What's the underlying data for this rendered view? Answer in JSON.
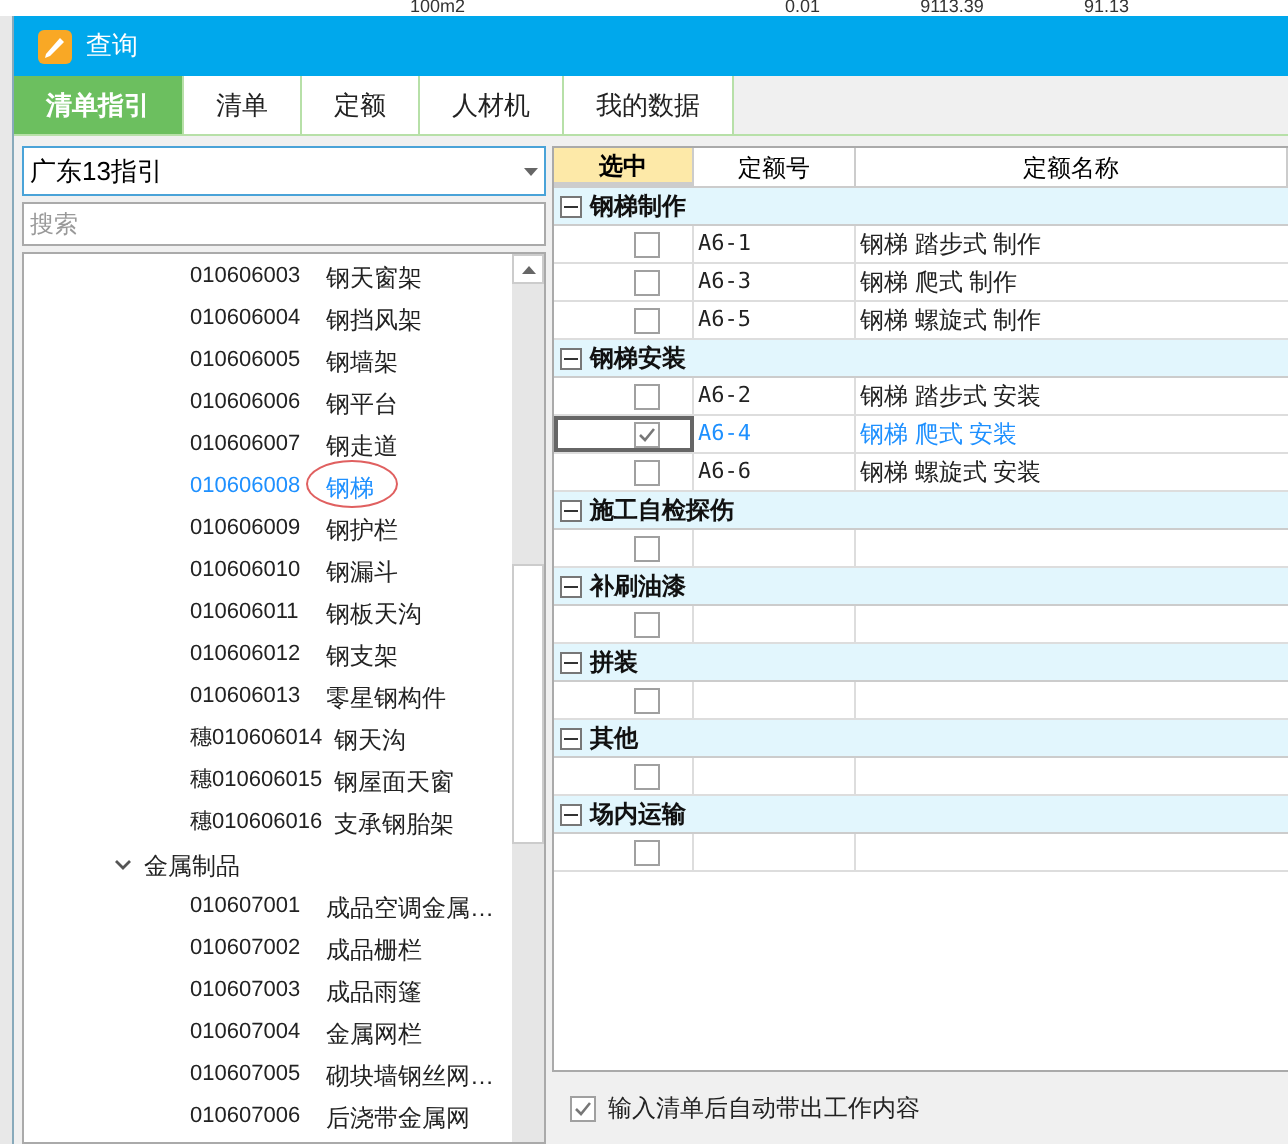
{
  "background_row": [
    "100m2",
    "0.01",
    "9113.39",
    "91.13"
  ],
  "window": {
    "title": "查询"
  },
  "tabs": [
    {
      "label": "清单指引",
      "selected": true
    },
    {
      "label": "清单",
      "selected": false
    },
    {
      "label": "定额",
      "selected": false
    },
    {
      "label": "人材机",
      "selected": false
    },
    {
      "label": "我的数据",
      "selected": false
    }
  ],
  "guide_select": {
    "value": "广东13指引"
  },
  "search": {
    "placeholder": "搜索"
  },
  "tree": [
    {
      "kind": "leaf",
      "code": "010606003",
      "name": "钢天窗架",
      "selected": false
    },
    {
      "kind": "leaf",
      "code": "010606004",
      "name": "钢挡风架",
      "selected": false
    },
    {
      "kind": "leaf",
      "code": "010606005",
      "name": "钢墙架",
      "selected": false
    },
    {
      "kind": "leaf",
      "code": "010606006",
      "name": "钢平台",
      "selected": false
    },
    {
      "kind": "leaf",
      "code": "010606007",
      "name": "钢走道",
      "selected": false
    },
    {
      "kind": "leaf",
      "code": "010606008",
      "name": "钢梯",
      "selected": true,
      "circled": true
    },
    {
      "kind": "leaf",
      "code": "010606009",
      "name": "钢护栏",
      "selected": false
    },
    {
      "kind": "leaf",
      "code": "010606010",
      "name": "钢漏斗",
      "selected": false
    },
    {
      "kind": "leaf",
      "code": "010606011",
      "name": "钢板天沟",
      "selected": false
    },
    {
      "kind": "leaf",
      "code": "010606012",
      "name": "钢支架",
      "selected": false
    },
    {
      "kind": "leaf",
      "code": "010606013",
      "name": "零星钢构件",
      "selected": false
    },
    {
      "kind": "leaf",
      "code": "穗010606014",
      "name": "钢天沟",
      "selected": false
    },
    {
      "kind": "leaf",
      "code": "穗010606015",
      "name": "钢屋面天窗",
      "selected": false
    },
    {
      "kind": "leaf",
      "code": "穗010606016",
      "name": "支承钢胎架",
      "selected": false
    },
    {
      "kind": "group",
      "label": "金属制品",
      "expanded": true,
      "children": [
        {
          "kind": "leaf",
          "code": "010607001",
          "name": "成品空调金属…",
          "selected": false
        },
        {
          "kind": "leaf",
          "code": "010607002",
          "name": "成品栅栏",
          "selected": false
        },
        {
          "kind": "leaf",
          "code": "010607003",
          "name": "成品雨篷",
          "selected": false
        },
        {
          "kind": "leaf",
          "code": "010607004",
          "name": "金属网栏",
          "selected": false
        },
        {
          "kind": "leaf",
          "code": "010607005",
          "name": "砌块墙钢丝网…",
          "selected": false
        },
        {
          "kind": "leaf",
          "code": "010607006",
          "name": "后浇带金属网",
          "selected": false
        }
      ]
    }
  ],
  "quota_table": {
    "columns": [
      "选中",
      "定额号",
      "定额名称"
    ],
    "groups": [
      {
        "title": "钢梯制作",
        "expanded": true,
        "rows": [
          {
            "checked": false,
            "code": "A6-1",
            "name": "钢梯 踏步式 制作",
            "selected": false
          },
          {
            "checked": false,
            "code": "A6-3",
            "name": "钢梯 爬式 制作",
            "selected": false
          },
          {
            "checked": false,
            "code": "A6-5",
            "name": "钢梯 螺旋式 制作",
            "selected": false
          }
        ]
      },
      {
        "title": "钢梯安装",
        "expanded": true,
        "rows": [
          {
            "checked": false,
            "code": "A6-2",
            "name": "钢梯 踏步式 安装",
            "selected": false
          },
          {
            "checked": true,
            "code": "A6-4",
            "name": "钢梯 爬式 安装",
            "selected": true
          },
          {
            "checked": false,
            "code": "A6-6",
            "name": "钢梯 螺旋式 安装",
            "selected": false
          }
        ]
      },
      {
        "title": "施工自检探伤",
        "expanded": true,
        "rows": [
          {
            "checked": false,
            "selected": false
          }
        ]
      },
      {
        "title": "补刷油漆",
        "expanded": true,
        "rows": [
          {
            "checked": false,
            "selected": false
          }
        ]
      },
      {
        "title": "拼装",
        "expanded": true,
        "rows": [
          {
            "checked": false,
            "selected": false
          }
        ]
      },
      {
        "title": "其他",
        "expanded": true,
        "rows": [
          {
            "checked": false,
            "selected": false
          }
        ]
      },
      {
        "title": "场内运输",
        "expanded": true,
        "rows": [
          {
            "checked": false,
            "selected": false
          }
        ]
      }
    ]
  },
  "auto_content": {
    "label": "输入清单后自动带出工作内容",
    "checked": true
  }
}
